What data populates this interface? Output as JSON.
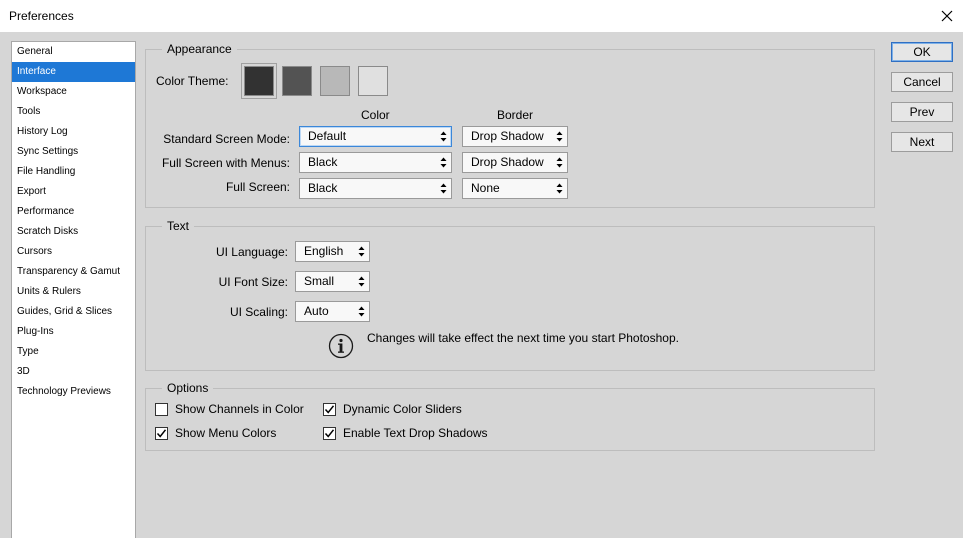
{
  "window": {
    "title": "Preferences"
  },
  "sidebar": {
    "items": [
      {
        "label": "General",
        "selected": false
      },
      {
        "label": "Interface",
        "selected": true
      },
      {
        "label": "Workspace",
        "selected": false
      },
      {
        "label": "Tools",
        "selected": false
      },
      {
        "label": "History Log",
        "selected": false
      },
      {
        "label": "Sync Settings",
        "selected": false
      },
      {
        "label": "File Handling",
        "selected": false
      },
      {
        "label": "Export",
        "selected": false
      },
      {
        "label": "Performance",
        "selected": false
      },
      {
        "label": "Scratch Disks",
        "selected": false
      },
      {
        "label": "Cursors",
        "selected": false
      },
      {
        "label": "Transparency & Gamut",
        "selected": false
      },
      {
        "label": "Units & Rulers",
        "selected": false
      },
      {
        "label": "Guides, Grid & Slices",
        "selected": false
      },
      {
        "label": "Plug-Ins",
        "selected": false
      },
      {
        "label": "Type",
        "selected": false
      },
      {
        "label": "3D",
        "selected": false
      },
      {
        "label": "Technology Previews",
        "selected": false
      }
    ]
  },
  "appearance": {
    "legend": "Appearance",
    "color_theme_label": "Color Theme:",
    "themes": [
      {
        "color": "#323232",
        "selected": true
      },
      {
        "color": "#535353",
        "selected": false
      },
      {
        "color": "#b8b8b8",
        "selected": false
      },
      {
        "color": "#e0e0e0",
        "selected": false
      }
    ],
    "col_color": "Color",
    "col_border": "Border",
    "standard_label": "Standard Screen Mode:",
    "standard_color": "Default",
    "standard_border": "Drop Shadow",
    "fullmenus_label": "Full Screen with Menus:",
    "fullmenus_color": "Black",
    "fullmenus_border": "Drop Shadow",
    "full_label": "Full Screen:",
    "full_color": "Black",
    "full_border": "None"
  },
  "text": {
    "legend": "Text",
    "language_label": "UI Language:",
    "language_value": "English",
    "fontsize_label": "UI Font Size:",
    "fontsize_value": "Small",
    "scaling_label": "UI Scaling:",
    "scaling_value": "Auto",
    "note": "Changes will take effect the next time you start Photoshop."
  },
  "options": {
    "legend": "Options",
    "show_channels": {
      "label": "Show Channels in Color",
      "checked": false
    },
    "dynamic_sliders": {
      "label": "Dynamic Color Sliders",
      "checked": true
    },
    "show_menu_colors": {
      "label": "Show Menu Colors",
      "checked": true
    },
    "text_shadows": {
      "label": "Enable Text Drop Shadows",
      "checked": true
    }
  },
  "buttons": {
    "ok": "OK",
    "cancel": "Cancel",
    "prev": "Prev",
    "next": "Next"
  },
  "colors": {
    "selection": "#1e78d6",
    "dialog_bg": "#d6d6d6",
    "default_button_border": "#2f6fc3"
  }
}
